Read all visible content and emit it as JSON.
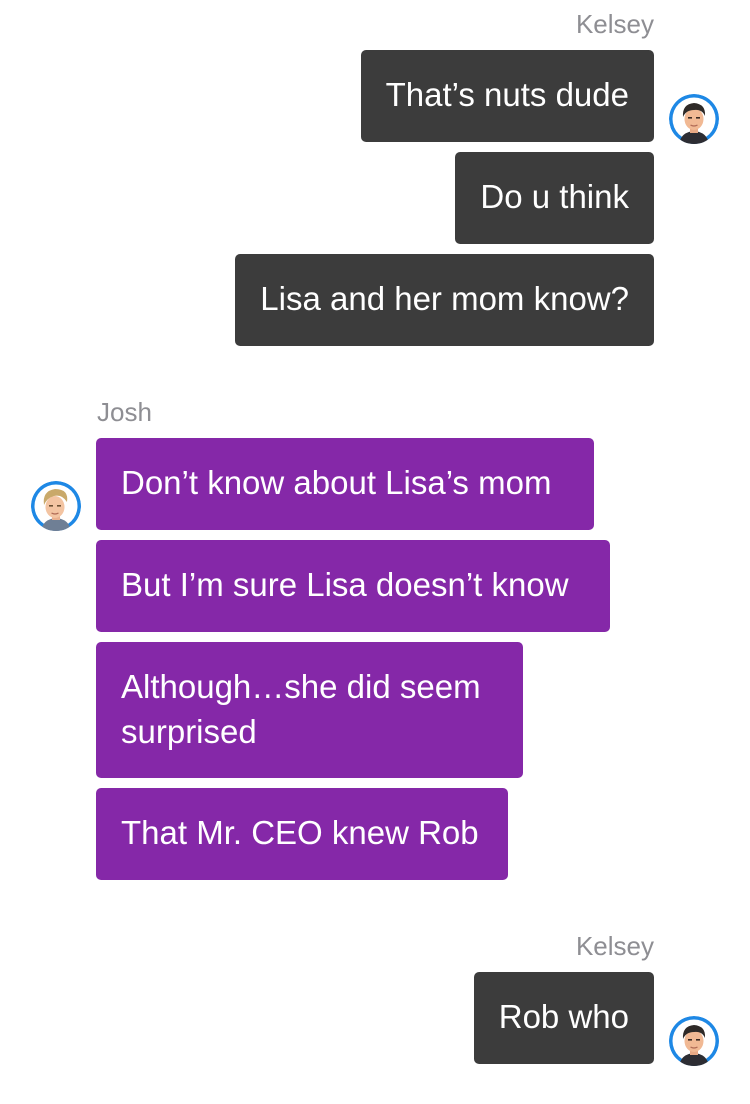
{
  "conversation": {
    "groups": [
      {
        "sender": "Kelsey",
        "messages": [
          "That’s nuts dude",
          "Do u think",
          "Lisa and her mom know?"
        ]
      },
      {
        "sender": "Josh",
        "messages": [
          "Don’t know about Lisa’s mom",
          "But I’m sure Lisa doesn’t know",
          "Although…she did seem surprised",
          "That Mr. CEO knew Rob"
        ]
      },
      {
        "sender": "Kelsey",
        "messages": [
          "Rob who"
        ]
      }
    ]
  },
  "colors": {
    "outgoing_bubble": "#3c3c3c",
    "incoming_bubble": "#8528a8",
    "sender_name": "#8e8e93",
    "avatar_ring": "#1e88e5"
  },
  "icons": {
    "kelsey_avatar": "dark-haired-man-avatar-icon",
    "josh_avatar": "blond-man-avatar-icon"
  }
}
